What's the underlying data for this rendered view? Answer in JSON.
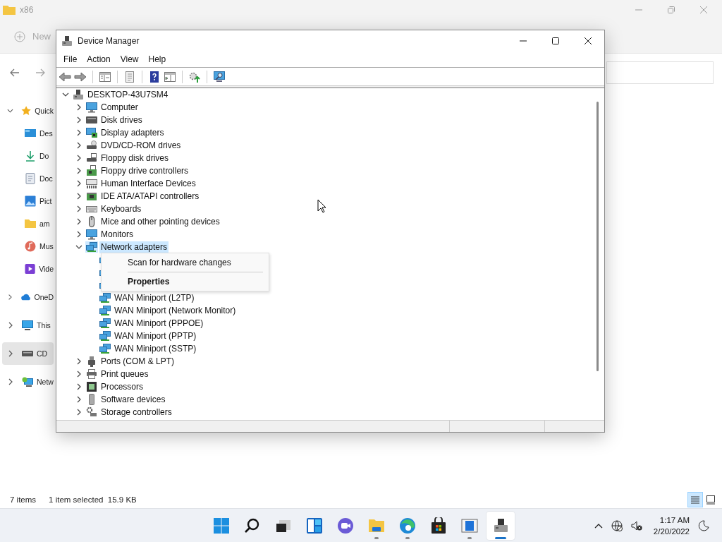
{
  "explorer": {
    "title": "x86",
    "new_button": "New",
    "sidebar": [
      {
        "label": "Quick",
        "kind": "star",
        "expanded": true,
        "selected": false,
        "children": [
          {
            "label": "Des",
            "kind": "desktop",
            "selected": false
          },
          {
            "label": "Do",
            "kind": "download",
            "selected": false
          },
          {
            "label": "Doc",
            "kind": "document",
            "selected": false
          },
          {
            "label": "Pict",
            "kind": "picture",
            "selected": false
          },
          {
            "label": "am",
            "kind": "folder",
            "selected": false
          },
          {
            "label": "Mus",
            "kind": "music",
            "selected": false
          },
          {
            "label": "Vide",
            "kind": "video",
            "selected": false
          }
        ]
      },
      {
        "label": "OneD",
        "kind": "cloud",
        "expanded": false,
        "selected": false
      },
      {
        "label": "This",
        "kind": "pc",
        "expanded": false,
        "selected": false
      },
      {
        "label": "CD",
        "kind": "drive",
        "expanded": false,
        "selected": true
      },
      {
        "label": "Netw",
        "kind": "network",
        "expanded": false,
        "selected": false
      }
    ],
    "status": [
      "7 items",
      "1 item selected  15.9 KB"
    ],
    "views": [
      {
        "kind": "details",
        "selected": true
      },
      {
        "kind": "tiles",
        "selected": false
      }
    ]
  },
  "device_manager": {
    "title": "Device Manager",
    "menu": [
      "File",
      "Action",
      "View",
      "Help"
    ],
    "toolbar": [
      {
        "kind": "back"
      },
      {
        "kind": "forward"
      },
      {
        "kind": "separator"
      },
      {
        "kind": "console-tree"
      },
      {
        "kind": "separator"
      },
      {
        "kind": "properties"
      },
      {
        "kind": "separator"
      },
      {
        "kind": "help"
      },
      {
        "kind": "action-pane"
      },
      {
        "kind": "separator"
      },
      {
        "kind": "update"
      },
      {
        "kind": "separator"
      },
      {
        "kind": "scan"
      }
    ],
    "tree": {
      "label": "DESKTOP-43U7SM4",
      "kind": "root",
      "expanded": true,
      "selected": false,
      "children": [
        {
          "label": "Computer",
          "kind": "computer",
          "expanded": false,
          "selected": false
        },
        {
          "label": "Disk drives",
          "kind": "disk",
          "expanded": false,
          "selected": false
        },
        {
          "label": "Display adapters",
          "kind": "display",
          "expanded": false,
          "selected": false
        },
        {
          "label": "DVD/CD-ROM drives",
          "kind": "dvd",
          "expanded": false,
          "selected": false
        },
        {
          "label": "Floppy disk drives",
          "kind": "floppy",
          "expanded": false,
          "selected": false
        },
        {
          "label": "Floppy drive controllers",
          "kind": "fdc",
          "expanded": false,
          "selected": false
        },
        {
          "label": "Human Interface Devices",
          "kind": "hid",
          "expanded": false,
          "selected": false
        },
        {
          "label": "IDE ATA/ATAPI controllers",
          "kind": "ide",
          "expanded": false,
          "selected": false
        },
        {
          "label": "Keyboards",
          "kind": "keyboard",
          "expanded": false,
          "selected": false
        },
        {
          "label": "Mice and other pointing devices",
          "kind": "mouse",
          "expanded": false,
          "selected": false
        },
        {
          "label": "Monitors",
          "kind": "monitor",
          "expanded": false,
          "selected": false
        },
        {
          "label": "Network adapters",
          "kind": "network",
          "expanded": true,
          "selected": true,
          "children": [
            {
              "kind": "network"
            },
            {
              "kind": "network"
            },
            {
              "kind": "network"
            },
            {
              "label": "WAN Miniport (L2TP)",
              "kind": "network",
              "selected": false
            },
            {
              "label": "WAN Miniport (Network Monitor)",
              "kind": "network",
              "selected": false
            },
            {
              "label": "WAN Miniport (PPPOE)",
              "kind": "network",
              "selected": false
            },
            {
              "label": "WAN Miniport (PPTP)",
              "kind": "network",
              "selected": false
            },
            {
              "label": "WAN Miniport (SSTP)",
              "kind": "network",
              "selected": false
            }
          ]
        },
        {
          "label": "Ports (COM & LPT)",
          "kind": "port",
          "expanded": false,
          "selected": false
        },
        {
          "label": "Print queues",
          "kind": "printer",
          "expanded": false,
          "selected": false
        },
        {
          "label": "Processors",
          "kind": "cpu",
          "expanded": false,
          "selected": false
        },
        {
          "label": "Software devices",
          "kind": "software",
          "expanded": false,
          "selected": false
        },
        {
          "label": "Storage controllers",
          "kind": "storage",
          "expanded": false,
          "selected": false
        }
      ]
    },
    "context_menu": [
      {
        "kind": "item",
        "label": "Scan for hardware changes"
      },
      {
        "kind": "separator"
      },
      {
        "kind": "default",
        "label": "Properties"
      }
    ]
  },
  "taskbar": {
    "apps": [
      {
        "kind": "start",
        "running": false,
        "active": false
      },
      {
        "kind": "search",
        "running": false,
        "active": false
      },
      {
        "kind": "task-view",
        "running": false,
        "active": false
      },
      {
        "kind": "widgets",
        "running": false,
        "active": false
      },
      {
        "kind": "chat",
        "running": false,
        "active": false
      },
      {
        "kind": "explorer",
        "running": true,
        "active": false
      },
      {
        "kind": "edge",
        "running": true,
        "active": false
      },
      {
        "kind": "store",
        "running": false,
        "active": false
      },
      {
        "kind": "window-app",
        "running": true,
        "active": false
      },
      {
        "kind": "device-manager",
        "running": true,
        "active": true
      }
    ],
    "time": "1:17 AM",
    "date": "2/20/2022"
  }
}
